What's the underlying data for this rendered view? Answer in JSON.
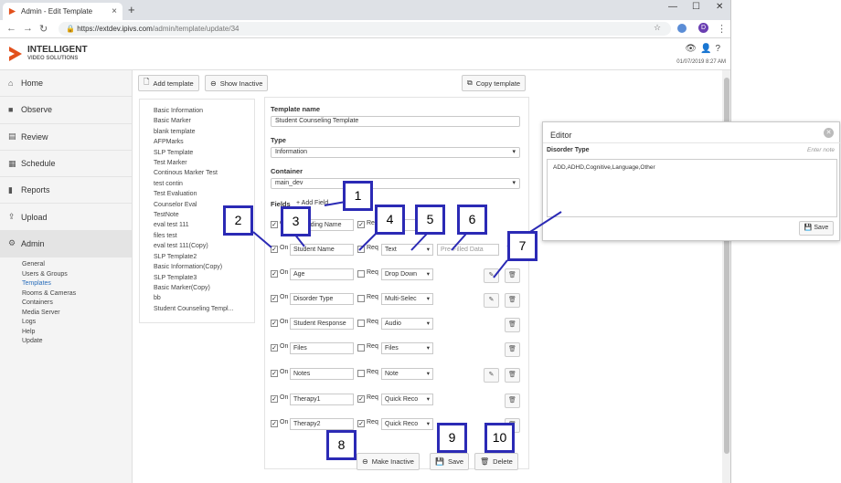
{
  "browser": {
    "tab_title": "Admin - Edit Template",
    "new_tab": "+",
    "url_host": "https://extdev.ipivs.com",
    "url_path": "/admin/template/update/34",
    "profile_initial": "D"
  },
  "app": {
    "logo_line1": "INTELLIGENT",
    "logo_line2": "VIDEO SOLUTIONS",
    "datetime": "01/07/2019 8:27 AM"
  },
  "sidebar": {
    "items": [
      {
        "label": "Home",
        "icon": "home-icon"
      },
      {
        "label": "Observe",
        "icon": "video-camera-icon"
      },
      {
        "label": "Review",
        "icon": "film-icon"
      },
      {
        "label": "Schedule",
        "icon": "calendar-icon"
      },
      {
        "label": "Reports",
        "icon": "bar-chart-icon"
      },
      {
        "label": "Upload",
        "icon": "upload-icon"
      },
      {
        "label": "Admin",
        "icon": "gear-icon"
      }
    ],
    "admin_sub": [
      "General",
      "Users & Groups",
      "Templates",
      "Rooms & Cameras",
      "Containers",
      "Media Server",
      "Logs",
      "Help",
      "Update"
    ]
  },
  "toolbar": {
    "add_template": "Add template",
    "show_inactive": "Show Inactive",
    "copy_template": "Copy template"
  },
  "templates": [
    "Basic Information",
    "Basic Marker",
    "blank template",
    "AFPMarks",
    "SLP Template",
    "Test Marker",
    "Continous Marker Test",
    "test contin",
    "Test Evaluation",
    "Counselor Eval",
    "TestNote",
    "eval test 111",
    "files test",
    "eval test 111(Copy)",
    "SLP Template2",
    "Basic Information(Copy)",
    "SLP Template3",
    "Basic Marker(Copy)",
    "bb",
    "Student Counseling Templ..."
  ],
  "form": {
    "name_label": "Template name",
    "name_value": "Student Counseling Template",
    "type_label": "Type",
    "type_value": "Information",
    "container_label": "Container",
    "container_value": "main_dev",
    "fields_label": "Fields",
    "add_field": "Add Field",
    "on_label": "On",
    "req_label": "Req",
    "prefill_placeholder": "Pre-Filled Data",
    "rows": [
      {
        "name": "Recording Name",
        "type": "Pre-F",
        "on": true,
        "req": true
      },
      {
        "name": "Student Name",
        "type": "Text",
        "on": true,
        "req": true,
        "prefill": true
      },
      {
        "name": "Age",
        "type": "Drop Down",
        "on": true,
        "req": false,
        "edit": true
      },
      {
        "name": "Disorder Type",
        "type": "Multi-Selec",
        "on": true,
        "req": false,
        "edit": true
      },
      {
        "name": "Student Response",
        "type": "Audio",
        "on": true,
        "req": false
      },
      {
        "name": "Files",
        "type": "Files",
        "on": true,
        "req": false
      },
      {
        "name": "Notes",
        "type": "Note",
        "on": true,
        "req": false,
        "edit": true
      },
      {
        "name": "Therapy1",
        "type": "Quick Reco",
        "on": true,
        "req": true
      },
      {
        "name": "Therapy2",
        "type": "Quick Reco",
        "on": true,
        "req": true
      }
    ],
    "make_inactive": "Make Inactive",
    "save": "Save",
    "delete": "Delete"
  },
  "editor": {
    "title": "Editor",
    "field_label": "Disorder Type",
    "enter_note": "Enter note",
    "values": "ADD,ADHD,Cognitive,Language,Other",
    "save": "Save"
  },
  "callouts": [
    "1",
    "2",
    "3",
    "4",
    "5",
    "6",
    "7",
    "8",
    "9",
    "10"
  ],
  "colors": {
    "callout_border": "#2b2ab5",
    "link_blue": "#2a6ebb"
  }
}
